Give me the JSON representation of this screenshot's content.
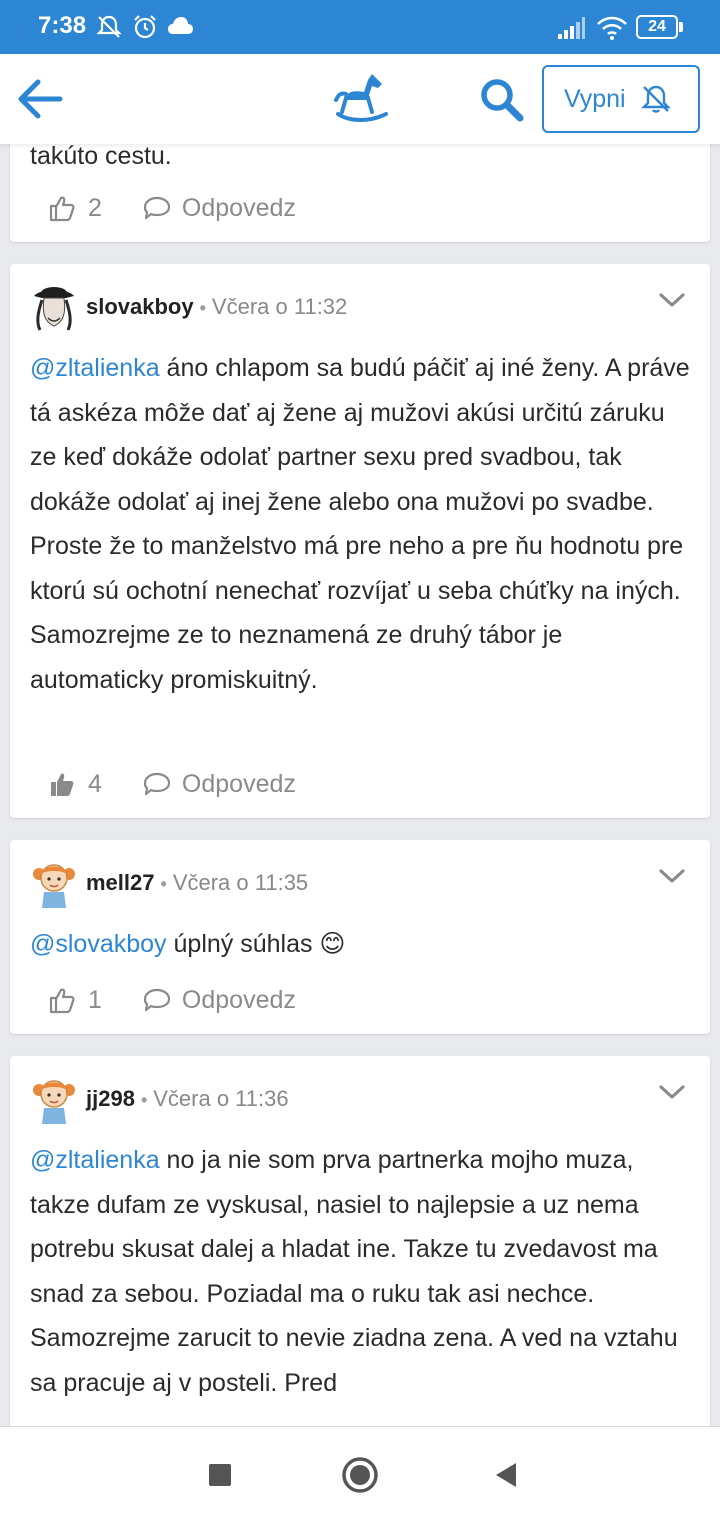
{
  "status_bar": {
    "time": "7:38",
    "battery": "24"
  },
  "header": {
    "mute_button_label": "Vypni"
  },
  "cards": [
    {
      "partial_text": "takúto cestu.",
      "likes": "2",
      "reply_label": "Odpovedz"
    },
    {
      "author": "slovakboy",
      "date": "Včera o 11:32",
      "mention": "@zltalienka",
      "text": " áno chlapom sa budú páčiť aj iné ženy. A práve tá askéza môže dať aj žene aj mužovi akúsi určitú záruku ze keď dokáže odolať partner sexu pred svadbou, tak dokáže odolať aj inej žene alebo ona mužovi po svadbe. Proste že to manželstvo má pre neho a pre ňu hodnotu pre ktorú sú ochotní nenechať rozvíjať u seba chúťky na iných. Samozrejme ze to neznamená ze druhý tábor je automaticky promiskuitný.",
      "likes": "4",
      "reply_label": "Odpovedz"
    },
    {
      "author": "mell27",
      "date": "Včera o 11:35",
      "mention": "@slovakboy",
      "text": " úplný súhlas 😊",
      "likes": "1",
      "reply_label": "Odpovedz"
    },
    {
      "author": "jj298",
      "date": "Včera o 11:36",
      "mention": "@zltalienka",
      "text": " no ja nie som prva partnerka mojho muza, takze dufam ze vyskusal, nasiel to najlepsie a uz nema potrebu skusat dalej a hladat ine. Takze tu zvedavost ma snad za sebou. Poziadal ma o ruku tak asi nechce. Samozrejme zarucit to nevie ziadna zena. A ved na vztahu sa pracuje aj v posteli. Pred"
    }
  ],
  "colors": {
    "accent": "#2d86d4",
    "status_bar": "#2d86d4",
    "background": "#e9eaee"
  }
}
